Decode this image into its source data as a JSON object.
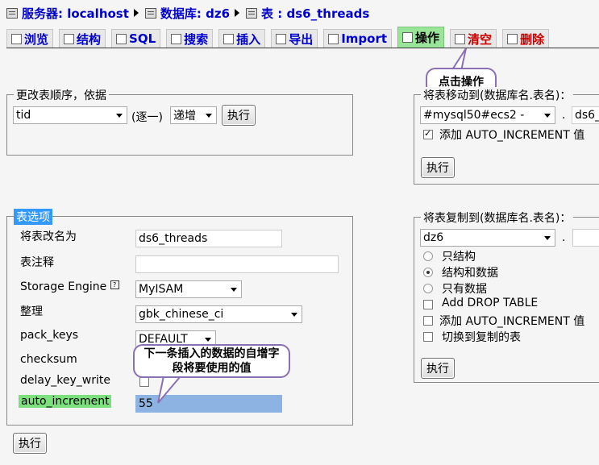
{
  "breadcrumb": {
    "server": "服务器: localhost",
    "database": "数据库: dz6",
    "table": "表 : ds6_threads"
  },
  "tabs": [
    {
      "label": "浏览"
    },
    {
      "label": "结构"
    },
    {
      "label": "SQL"
    },
    {
      "label": "搜索"
    },
    {
      "label": "插入"
    },
    {
      "label": "导出"
    },
    {
      "label": "Import"
    },
    {
      "label": "操作"
    },
    {
      "label": "清空"
    },
    {
      "label": "删除"
    }
  ],
  "callouts": {
    "operate": "点击操作",
    "autoinc": "下一条插入的数据的自增字段将要使用的值"
  },
  "order": {
    "legend": "更改表顺序，依据",
    "field": "tid",
    "suffix": "(逐一)",
    "direction": "递增",
    "exec": "执行"
  },
  "move": {
    "legend": "将表移动到(数据库名.表名)：",
    "db": "#mysql50#ecs2 -",
    "dot": ".",
    "table": "ds6_",
    "autoinc_label": "添加  AUTO_INCREMENT 值",
    "exec": "执行"
  },
  "options": {
    "legend": "表选项",
    "rename_label": "将表改名为",
    "rename_value": "ds6_threads",
    "comment_label": "表注释",
    "comment_value": "",
    "engine_label": "Storage Engine",
    "engine_value": "MyISAM",
    "collation_label": "整理",
    "collation_value": "gbk_chinese_ci",
    "packkeys_label": "pack_keys",
    "packkeys_value": "DEFAULT",
    "checksum_label": "checksum",
    "delay_label": "delay_key_write",
    "autoinc_label": "auto_increment",
    "autoinc_value": "55",
    "exec": "执行"
  },
  "copy": {
    "legend": "将表复制到(数据库名.表名)：",
    "db": "dz6",
    "dot": ".",
    "opt_structure": "只结构",
    "opt_structure_data": "结构和数据",
    "opt_data": "只有数据",
    "add_drop": "Add DROP TABLE",
    "add_autoinc": "添加  AUTO_INCREMENT 值",
    "switch": "切换到复制的表",
    "exec": "执行"
  }
}
